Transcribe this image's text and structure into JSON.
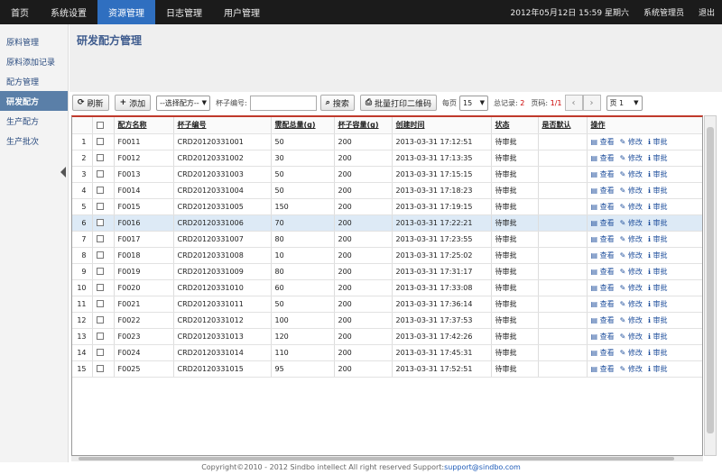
{
  "nav": {
    "items": [
      "首页",
      "系统设置",
      "资源管理",
      "日志管理",
      "用户管理"
    ],
    "datetime": "2012年05月12日 15:59 星期六",
    "user": "系统管理员",
    "logout": "退出"
  },
  "sidebar": {
    "items": [
      "原料管理",
      "原料添加记录",
      "配方管理",
      "研发配方",
      "生产配方",
      "生产批次"
    ]
  },
  "page": {
    "title": "研发配方管理"
  },
  "toolbar": {
    "refresh": "刷新",
    "add": "添加",
    "select_formula": "--选择配方--",
    "cup_label": "杯子编号:",
    "search": "搜索",
    "print_qr": "批量打印二维码",
    "per_page_label": "每页",
    "per_page_value": "15",
    "total_label": "总记录:",
    "total_value": "2",
    "pages_label": "页码:",
    "pages_value": "1/1",
    "page_select": "页 1"
  },
  "table": {
    "headers": [
      "配方名称",
      "杯子编号",
      "需配总量(g)",
      "杯子容量(g)",
      "创建时间",
      "状态",
      "是否默认",
      "操作"
    ],
    "actions": [
      "查看",
      "修改",
      "审批"
    ],
    "rows": [
      {
        "n": "1",
        "name": "F0011",
        "cup": "CRD20120331001",
        "total": "50",
        "cap": "200",
        "time": "2013-03-31 17:12:51",
        "status": "待审批"
      },
      {
        "n": "2",
        "name": "F0012",
        "cup": "CRD20120331002",
        "total": "30",
        "cap": "200",
        "time": "2013-03-31 17:13:35",
        "status": "待审批"
      },
      {
        "n": "3",
        "name": "F0013",
        "cup": "CRD20120331003",
        "total": "50",
        "cap": "200",
        "time": "2013-03-31 17:15:15",
        "status": "待审批"
      },
      {
        "n": "4",
        "name": "F0014",
        "cup": "CRD20120331004",
        "total": "50",
        "cap": "200",
        "time": "2013-03-31 17:18:23",
        "status": "待审批"
      },
      {
        "n": "5",
        "name": "F0015",
        "cup": "CRD20120331005",
        "total": "150",
        "cap": "200",
        "time": "2013-03-31 17:19:15",
        "status": "待审批"
      },
      {
        "n": "6",
        "name": "F0016",
        "cup": "CRD20120331006",
        "total": "70",
        "cap": "200",
        "time": "2013-03-31 17:22:21",
        "status": "待审批"
      },
      {
        "n": "7",
        "name": "F0017",
        "cup": "CRD20120331007",
        "total": "80",
        "cap": "200",
        "time": "2013-03-31 17:23:55",
        "status": "待审批"
      },
      {
        "n": "8",
        "name": "F0018",
        "cup": "CRD20120331008",
        "total": "10",
        "cap": "200",
        "time": "2013-03-31 17:25:02",
        "status": "待审批"
      },
      {
        "n": "9",
        "name": "F0019",
        "cup": "CRD20120331009",
        "total": "80",
        "cap": "200",
        "time": "2013-03-31 17:31:17",
        "status": "待审批"
      },
      {
        "n": "10",
        "name": "F0020",
        "cup": "CRD20120331010",
        "total": "60",
        "cap": "200",
        "time": "2013-03-31 17:33:08",
        "status": "待审批"
      },
      {
        "n": "11",
        "name": "F0021",
        "cup": "CRD20120331011",
        "total": "50",
        "cap": "200",
        "time": "2013-03-31 17:36:14",
        "status": "待审批"
      },
      {
        "n": "12",
        "name": "F0022",
        "cup": "CRD20120331012",
        "total": "100",
        "cap": "200",
        "time": "2013-03-31 17:37:53",
        "status": "待审批"
      },
      {
        "n": "13",
        "name": "F0023",
        "cup": "CRD20120331013",
        "total": "120",
        "cap": "200",
        "time": "2013-03-31 17:42:26",
        "status": "待审批"
      },
      {
        "n": "14",
        "name": "F0024",
        "cup": "CRD20120331014",
        "total": "110",
        "cap": "200",
        "time": "2013-03-31 17:45:31",
        "status": "待审批"
      },
      {
        "n": "15",
        "name": "F0025",
        "cup": "CRD20120331015",
        "total": "95",
        "cap": "200",
        "time": "2013-03-31 17:52:51",
        "status": "待审批"
      }
    ]
  },
  "footer": {
    "text": "Copyright©2010 - 2012 Sindbo intellect All right reserved Support:",
    "email": "support@sindbo.com"
  },
  "colors": {
    "accent": "#2f6fc0",
    "sidebar_active": "#5a7fa8",
    "table_top_border": "#c0392b",
    "link": "#1f4f9c"
  }
}
